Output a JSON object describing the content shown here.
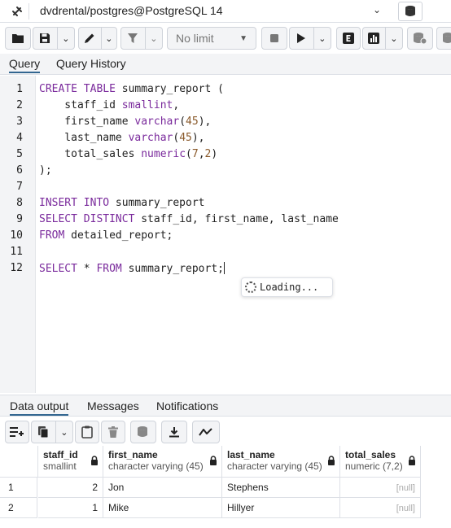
{
  "connection": {
    "label": "dvdrental/postgres@PostgreSQL 14"
  },
  "toolbar": {
    "limit_label": "No limit"
  },
  "query_tabs": [
    {
      "label": "Query"
    },
    {
      "label": "Query History"
    }
  ],
  "editor": {
    "line_numbers": [
      "1",
      "2",
      "3",
      "4",
      "5",
      "6",
      "7",
      "8",
      "9",
      "10",
      "11",
      "12"
    ],
    "loading_text": "Loading..."
  },
  "result_tabs": [
    {
      "label": "Data output"
    },
    {
      "label": "Messages"
    },
    {
      "label": "Notifications"
    }
  ],
  "grid": {
    "columns": [
      {
        "name": "staff_id",
        "type": "smallint"
      },
      {
        "name": "first_name",
        "type": "character varying (45)"
      },
      {
        "name": "last_name",
        "type": "character varying (45)"
      },
      {
        "name": "total_sales",
        "type": "numeric (7,2)"
      }
    ],
    "rows": [
      {
        "num": "1",
        "staff_id": "2",
        "first_name": "Jon",
        "last_name": "Stephens",
        "total_sales": "[null]"
      },
      {
        "num": "2",
        "staff_id": "1",
        "first_name": "Mike",
        "last_name": "Hillyer",
        "total_sales": "[null]"
      }
    ]
  },
  "colors": {
    "accent": "#326690",
    "keyword": "#7a2a9c",
    "number": "#8a5a2b"
  }
}
